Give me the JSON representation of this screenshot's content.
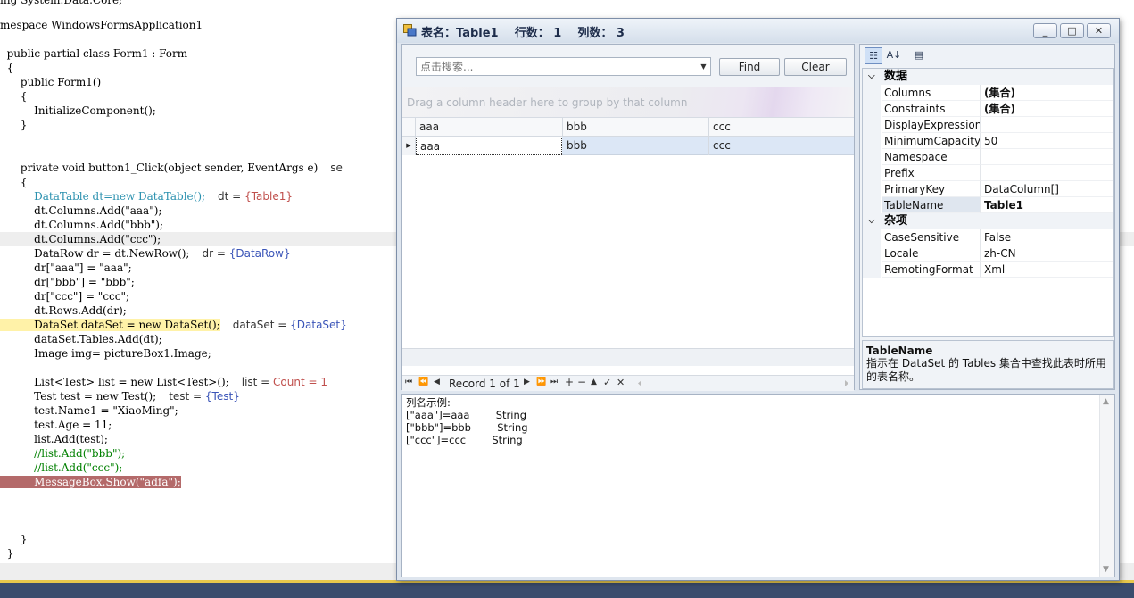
{
  "editor": {
    "lines": [
      {
        "text": "ing System.Data.Core;"
      },
      {
        "text": "mespace WindowsFormsApplication1"
      },
      {
        "text": "  public partial class Form1 : Form"
      },
      {
        "text": "  {"
      },
      {
        "text": "      public Form1()"
      },
      {
        "text": "      {"
      },
      {
        "text": "          InitializeComponent();"
      },
      {
        "text": "      }"
      },
      {
        "text": "      private void button1_Click(object sender, EventArgs e)"
      },
      {
        "text": "      {"
      },
      {
        "text": "          DataTable dt=new DataTable();"
      },
      {
        "text": "          dt.Columns.Add(\"aaa\");"
      },
      {
        "text": "          dt.Columns.Add(\"bbb\");"
      },
      {
        "text": "          dt.Columns.Add(\"ccc\");"
      },
      {
        "text": "          DataRow dr = dt.NewRow();"
      },
      {
        "text": "          dr[\"aaa\"] = \"aaa\";"
      },
      {
        "text": "          dr[\"bbb\"] = \"bbb\";"
      },
      {
        "text": "          dr[\"ccc\"] = \"ccc\";"
      },
      {
        "text": "          dt.Rows.Add(dr);"
      },
      {
        "text": "          DataSet dataSet = new DataSet();"
      },
      {
        "text": "          dataSet.Tables.Add(dt);"
      },
      {
        "text": "          Image img= pictureBox1.Image;"
      },
      {
        "text": "          List<Test> list = new List<Test>();"
      },
      {
        "text": "          Test test = new Test();"
      },
      {
        "text": "          test.Name1 = \"XiaoMing\";"
      },
      {
        "text": "          test.Age = 11;"
      },
      {
        "text": "          list.Add(test);"
      },
      {
        "text": "          //list.Add(\"bbb\");"
      },
      {
        "text": "          //list.Add(\"ccc\");"
      },
      {
        "text": "          MessageBox.Show(\"adfa\");"
      },
      {
        "text": "      }"
      },
      {
        "text": "  }"
      }
    ],
    "datatips": {
      "click_trunc": "se",
      "dt_label": "dt = ",
      "dt_value": "{Table1}",
      "dr_label": "dr = ",
      "dr_value": "{DataRow}",
      "ds_label": "dataSet = ",
      "ds_value": "{DataSet}",
      "list_label": "list = ",
      "list_value": "Count = 1",
      "test_label": "test = ",
      "test_value": "{Test}"
    }
  },
  "window": {
    "title": "表名：Table1    行数： 1    列数： 3",
    "minimize": "_",
    "maximize": "□",
    "close": "✕"
  },
  "grid": {
    "search_placeholder": "点击搜索...",
    "find_label": "Find",
    "clear_label": "Clear",
    "group_hint": "Drag a column header here to group by that column",
    "columns": [
      "aaa",
      "bbb",
      "ccc"
    ],
    "rows": [
      [
        "aaa",
        "bbb",
        "ccc"
      ]
    ],
    "record_text": "Record 1 of 1"
  },
  "properties": {
    "categories": [
      {
        "name": "数据",
        "items": [
          {
            "name": "Columns",
            "value": "(集合)",
            "bold": true
          },
          {
            "name": "Constraints",
            "value": "(集合)",
            "bold": true
          },
          {
            "name": "DisplayExpression",
            "value": ""
          },
          {
            "name": "MinimumCapacity",
            "value": "50"
          },
          {
            "name": "Namespace",
            "value": ""
          },
          {
            "name": "Prefix",
            "value": ""
          },
          {
            "name": "PrimaryKey",
            "value": "DataColumn[]"
          },
          {
            "name": "TableName",
            "value": "Table1",
            "bold": true,
            "selected": true
          }
        ]
      },
      {
        "name": "杂项",
        "items": [
          {
            "name": "CaseSensitive",
            "value": "False"
          },
          {
            "name": "Locale",
            "value": "zh-CN"
          },
          {
            "name": "RemotingFormat",
            "value": "Xml"
          }
        ]
      }
    ],
    "description_title": "TableName",
    "description_text": "指示在 DataSet 的 Tables 集合中查找此表时所用的表名称。"
  },
  "output": {
    "text": "列名示例:\n[\"aaa\"]=aaa        String\n[\"bbb\"]=bbb        String\n[\"ccc\"]=ccc        String"
  }
}
